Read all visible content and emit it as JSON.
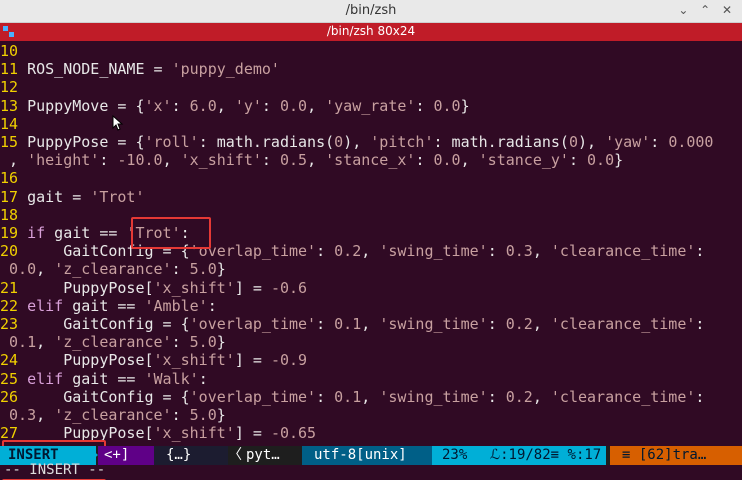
{
  "window": {
    "title": "/bin/zsh",
    "tab_title": "/bin/zsh 80x24",
    "controls": [
      "minimize-icon",
      "maximize-icon",
      "close-icon"
    ]
  },
  "editor": {
    "lines": [
      {
        "n": "10",
        "segs": []
      },
      {
        "n": "11",
        "segs": [
          [
            "plain",
            "ROS_NODE_NAME = "
          ],
          [
            "str",
            "'puppy_demo'"
          ]
        ]
      },
      {
        "n": "12",
        "segs": []
      },
      {
        "n": "13",
        "segs": [
          [
            "plain",
            "PuppyMove = {"
          ],
          [
            "str",
            "'x'"
          ],
          [
            "plain",
            ": "
          ],
          [
            "num",
            "6.0"
          ],
          [
            "plain",
            ", "
          ],
          [
            "str",
            "'y'"
          ],
          [
            "plain",
            ": "
          ],
          [
            "num",
            "0.0"
          ],
          [
            "plain",
            ", "
          ],
          [
            "str",
            "'yaw_rate'"
          ],
          [
            "plain",
            ": "
          ],
          [
            "num",
            "0.0"
          ],
          [
            "plain",
            "}"
          ]
        ]
      },
      {
        "n": "14",
        "segs": []
      },
      {
        "n": "15",
        "segs": [
          [
            "plain",
            "PuppyPose = {"
          ],
          [
            "str",
            "'roll'"
          ],
          [
            "plain",
            ": math.radians("
          ],
          [
            "num",
            "0"
          ],
          [
            "plain",
            "), "
          ],
          [
            "str",
            "'pitch'"
          ],
          [
            "plain",
            ": math.radians("
          ],
          [
            "num",
            "0"
          ],
          [
            "plain",
            "), "
          ],
          [
            "str",
            "'yaw'"
          ],
          [
            "plain",
            ": "
          ],
          [
            "num",
            "0.000"
          ]
        ]
      },
      {
        "n": "",
        "segs": [
          [
            "plain",
            ", "
          ],
          [
            "str",
            "'height'"
          ],
          [
            "plain",
            ": "
          ],
          [
            "num",
            "-10.0"
          ],
          [
            "plain",
            ", "
          ],
          [
            "str",
            "'x_shift'"
          ],
          [
            "plain",
            ": "
          ],
          [
            "num",
            "0.5"
          ],
          [
            "plain",
            ", "
          ],
          [
            "str",
            "'stance_x'"
          ],
          [
            "plain",
            ": "
          ],
          [
            "num",
            "0.0"
          ],
          [
            "plain",
            ", "
          ],
          [
            "str",
            "'stance_y'"
          ],
          [
            "plain",
            ": "
          ],
          [
            "num",
            "0.0"
          ],
          [
            "plain",
            "}"
          ]
        ]
      },
      {
        "n": "16",
        "segs": []
      },
      {
        "n": "17",
        "segs": [
          [
            "plain",
            "gait = "
          ],
          [
            "str",
            "'Trot'"
          ]
        ]
      },
      {
        "n": "18",
        "segs": []
      },
      {
        "n": "19",
        "segs": [
          [
            "kw",
            "if"
          ],
          [
            "plain",
            " gait == "
          ],
          [
            "str",
            "'Trot'"
          ],
          [
            "plain",
            ":"
          ]
        ]
      },
      {
        "n": "20",
        "segs": [
          [
            "plain",
            "    GaitConfig = {"
          ],
          [
            "str",
            "'overlap_time'"
          ],
          [
            "plain",
            ": "
          ],
          [
            "num",
            "0.2"
          ],
          [
            "plain",
            ", "
          ],
          [
            "str",
            "'swing_time'"
          ],
          [
            "plain",
            ": "
          ],
          [
            "num",
            "0.3"
          ],
          [
            "plain",
            ", "
          ],
          [
            "str",
            "'clearance_time'"
          ],
          [
            "plain",
            ":"
          ]
        ]
      },
      {
        "n": "",
        "segs": [
          [
            "num",
            "0.0"
          ],
          [
            "plain",
            ", "
          ],
          [
            "str",
            "'z_clearance'"
          ],
          [
            "plain",
            ": "
          ],
          [
            "num",
            "5.0"
          ],
          [
            "plain",
            "}"
          ]
        ]
      },
      {
        "n": "21",
        "segs": [
          [
            "plain",
            "    PuppyPose["
          ],
          [
            "str",
            "'x_shift'"
          ],
          [
            "plain",
            "] = "
          ],
          [
            "num",
            "-0.6"
          ]
        ]
      },
      {
        "n": "22",
        "segs": [
          [
            "kw",
            "elif"
          ],
          [
            "plain",
            " gait == "
          ],
          [
            "str",
            "'Amble'"
          ],
          [
            "plain",
            ":"
          ]
        ]
      },
      {
        "n": "23",
        "segs": [
          [
            "plain",
            "    GaitConfig = {"
          ],
          [
            "str",
            "'overlap_time'"
          ],
          [
            "plain",
            ": "
          ],
          [
            "num",
            "0.1"
          ],
          [
            "plain",
            ", "
          ],
          [
            "str",
            "'swing_time'"
          ],
          [
            "plain",
            ": "
          ],
          [
            "num",
            "0.2"
          ],
          [
            "plain",
            ", "
          ],
          [
            "str",
            "'clearance_time'"
          ],
          [
            "plain",
            ":"
          ]
        ]
      },
      {
        "n": "",
        "segs": [
          [
            "num",
            "0.1"
          ],
          [
            "plain",
            ", "
          ],
          [
            "str",
            "'z_clearance'"
          ],
          [
            "plain",
            ": "
          ],
          [
            "num",
            "5.0"
          ],
          [
            "plain",
            "}"
          ]
        ]
      },
      {
        "n": "24",
        "segs": [
          [
            "plain",
            "    PuppyPose["
          ],
          [
            "str",
            "'x_shift'"
          ],
          [
            "plain",
            "] = "
          ],
          [
            "num",
            "-0.9"
          ]
        ]
      },
      {
        "n": "25",
        "segs": [
          [
            "kw",
            "elif"
          ],
          [
            "plain",
            " gait == "
          ],
          [
            "str",
            "'Walk'"
          ],
          [
            "plain",
            ":"
          ]
        ]
      },
      {
        "n": "26",
        "segs": [
          [
            "plain",
            "    GaitConfig = {"
          ],
          [
            "str",
            "'overlap_time'"
          ],
          [
            "plain",
            ": "
          ],
          [
            "num",
            "0.1"
          ],
          [
            "plain",
            ", "
          ],
          [
            "str",
            "'swing_time'"
          ],
          [
            "plain",
            ": "
          ],
          [
            "num",
            "0.2"
          ],
          [
            "plain",
            ", "
          ],
          [
            "str",
            "'clearance_time'"
          ],
          [
            "plain",
            ":"
          ]
        ]
      },
      {
        "n": "",
        "segs": [
          [
            "num",
            "0.3"
          ],
          [
            "plain",
            ", "
          ],
          [
            "str",
            "'z_clearance'"
          ],
          [
            "plain",
            ": "
          ],
          [
            "num",
            "5.0"
          ],
          [
            "plain",
            "}"
          ]
        ]
      },
      {
        "n": "27",
        "segs": [
          [
            "plain",
            "    PuppyPose["
          ],
          [
            "str",
            "'x_shift'"
          ],
          [
            "plain",
            "] = "
          ],
          [
            "num",
            "-0.65"
          ]
        ]
      }
    ]
  },
  "statusline": {
    "mode": "INSERT",
    "modified": "<+]",
    "scope": "{…}",
    "filetype": "pyt…",
    "encoding": "utf-8[unix]",
    "percent": "23%",
    "position": "ℒ:19/82≡ %:17",
    "trailing": "≡ [62]tra…"
  },
  "cmdline": "-- INSERT --",
  "colors": {
    "bg": "#300a24",
    "tab": "#c01c28",
    "linenum": "#f0d000",
    "highlight_box": "#e53935"
  }
}
